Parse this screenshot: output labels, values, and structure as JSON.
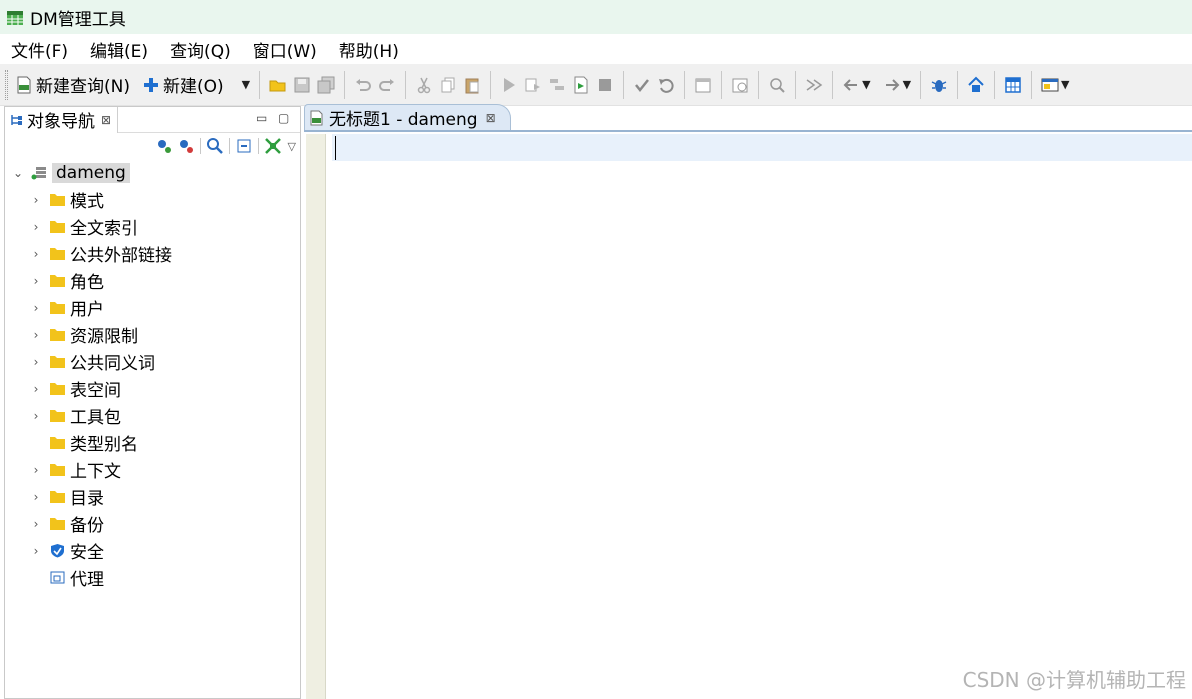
{
  "window": {
    "title": "DM管理工具"
  },
  "menu": [
    "文件(F)",
    "编辑(E)",
    "查询(Q)",
    "窗口(W)",
    "帮助(H)"
  ],
  "toolbar": {
    "new_query_label": "新建查询(N)",
    "new_label": "新建(O)"
  },
  "navigator": {
    "tab_label": "对象导航",
    "root": "dameng",
    "items": [
      {
        "label": "模式",
        "icon": "folder-icon",
        "expandable": true
      },
      {
        "label": "全文索引",
        "icon": "folder-icon",
        "expandable": true
      },
      {
        "label": "公共外部链接",
        "icon": "folder-icon",
        "expandable": true
      },
      {
        "label": "角色",
        "icon": "folder-icon",
        "expandable": true
      },
      {
        "label": "用户",
        "icon": "folder-icon",
        "expandable": true
      },
      {
        "label": "资源限制",
        "icon": "folder-icon",
        "expandable": true
      },
      {
        "label": "公共同义词",
        "icon": "folder-icon",
        "expandable": true
      },
      {
        "label": "表空间",
        "icon": "folder-icon",
        "expandable": true
      },
      {
        "label": "工具包",
        "icon": "folder-icon",
        "expandable": true
      },
      {
        "label": "类型别名",
        "icon": "folder-icon",
        "expandable": false
      },
      {
        "label": "上下文",
        "icon": "folder-icon",
        "expandable": true
      },
      {
        "label": "目录",
        "icon": "folder-icon",
        "expandable": true
      },
      {
        "label": "备份",
        "icon": "folder-icon",
        "expandable": true
      },
      {
        "label": "安全",
        "icon": "shield-icon",
        "expandable": true
      },
      {
        "label": "代理",
        "icon": "agent-icon",
        "expandable": false
      }
    ]
  },
  "editor": {
    "tab_label": "无标题1 - dameng"
  },
  "watermark": "CSDN @计算机辅助工程",
  "colors": {
    "titlebar_bg": "#e9f6ee",
    "folder": "#f2c31b",
    "current_line": "#e8f1fb",
    "tab_active": "#dde8f5"
  }
}
